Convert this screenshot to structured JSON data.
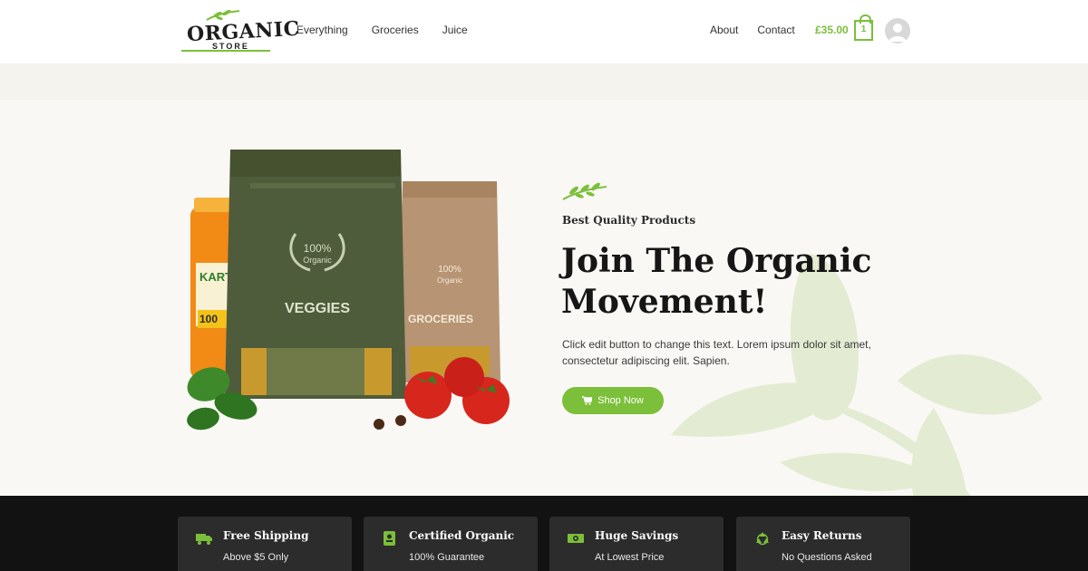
{
  "header": {
    "logo": {
      "word": "ORGANIC",
      "sub": "STORE"
    },
    "nav_left": [
      "Everything",
      "Groceries",
      "Juice"
    ],
    "nav_right": [
      "About",
      "Contact"
    ],
    "cart": {
      "total": "£35.00",
      "count": "1"
    },
    "avatar_icon": "user-avatar-icon"
  },
  "hero": {
    "eyebrow": "Best Quality Products",
    "title": "Join The Organic Movement!",
    "text": "Click edit button to change this text. Lorem ipsum dolor sit amet, consectetur adipiscing elit. Sapien.",
    "button": {
      "label": "Shop Now",
      "icon": "cart-icon"
    },
    "product_image": {
      "bag1_label": "VEGGIES",
      "bag1_badge_top": "100%",
      "bag1_badge_bottom": "Organic",
      "bag2_label": "GROCERIES",
      "bag2_badge_top": "100%",
      "bag2_badge_bottom": "Organic",
      "jar_label": "KART",
      "jar_badge": "100"
    }
  },
  "features": [
    {
      "title": "Free Shipping",
      "subtitle": "Above $5 Only",
      "icon": "truck-icon"
    },
    {
      "title": "Certified Organic",
      "subtitle": "100% Guarantee",
      "icon": "certificate-icon"
    },
    {
      "title": "Huge Savings",
      "subtitle": "At Lowest Price",
      "icon": "money-icon"
    },
    {
      "title": "Easy Returns",
      "subtitle": "No Questions Asked",
      "icon": "recycle-icon"
    }
  ],
  "colors": {
    "accent": "#7cbf3a",
    "dark": "#121212",
    "card": "#2c2c2c",
    "hero_bg": "#f9f8f5"
  }
}
